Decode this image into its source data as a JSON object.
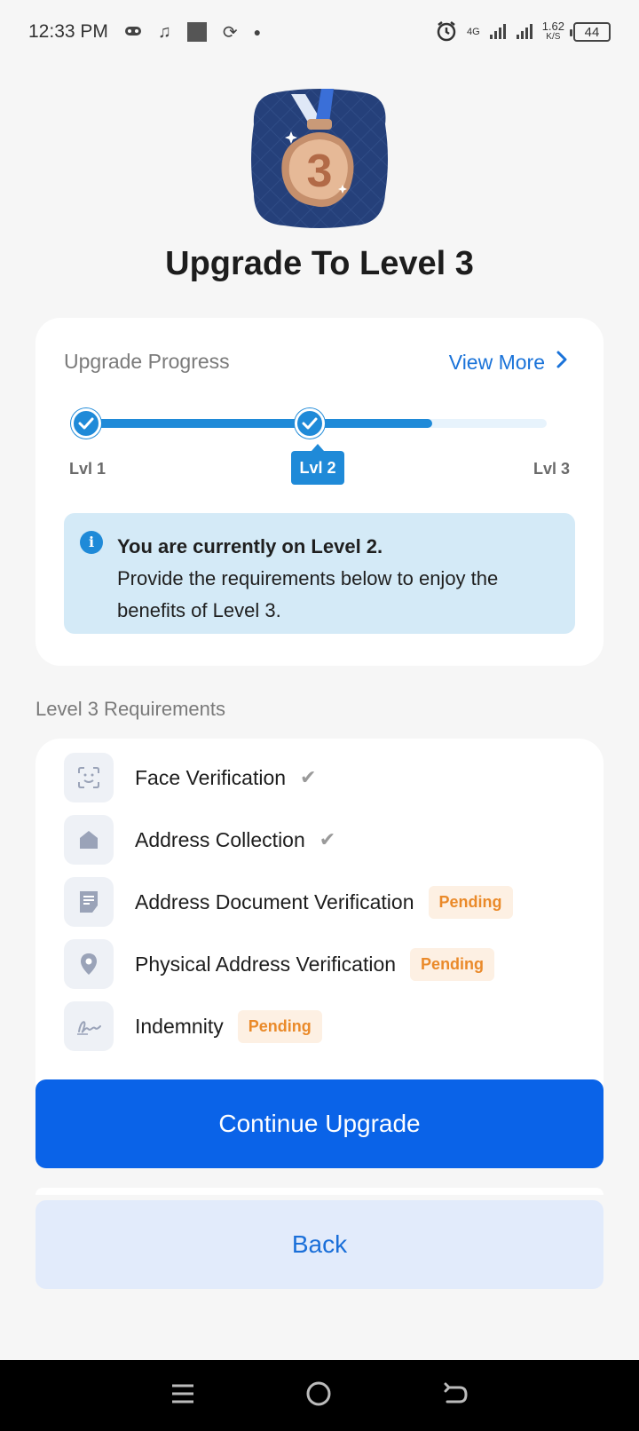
{
  "status_bar": {
    "time": "12:33 PM",
    "network": "4G",
    "speed_value": "1.62",
    "speed_unit": "K/S",
    "battery": "44"
  },
  "header": {
    "medal_number": "3",
    "title": "Upgrade To Level 3"
  },
  "progress": {
    "label": "Upgrade Progress",
    "view_more": "View More",
    "levels": [
      "Lvl 1",
      "Lvl 2",
      "Lvl 3"
    ],
    "current_level": "Lvl 2",
    "fill_percent": 75
  },
  "info": {
    "bold": "You are currently on Level 2.",
    "text": "Provide the requirements below to enjoy the benefits of Level 3."
  },
  "requirements": {
    "heading": "Level 3 Requirements",
    "items": [
      {
        "label": "Face Verification",
        "status": "done",
        "icon": "face-scan-icon"
      },
      {
        "label": "Address Collection",
        "status": "done",
        "icon": "home-icon"
      },
      {
        "label": "Address Document Verification",
        "status": "Pending",
        "icon": "document-icon"
      },
      {
        "label": "Physical Address Verification",
        "status": "Pending",
        "icon": "location-pin-icon"
      },
      {
        "label": "Indemnity",
        "status": "Pending",
        "icon": "signature-icon"
      }
    ]
  },
  "buttons": {
    "continue": "Continue Upgrade",
    "back": "Back"
  },
  "colors": {
    "primary": "#0a63e8",
    "accent": "#1f8ad8",
    "pending": "#ea8a2a"
  }
}
